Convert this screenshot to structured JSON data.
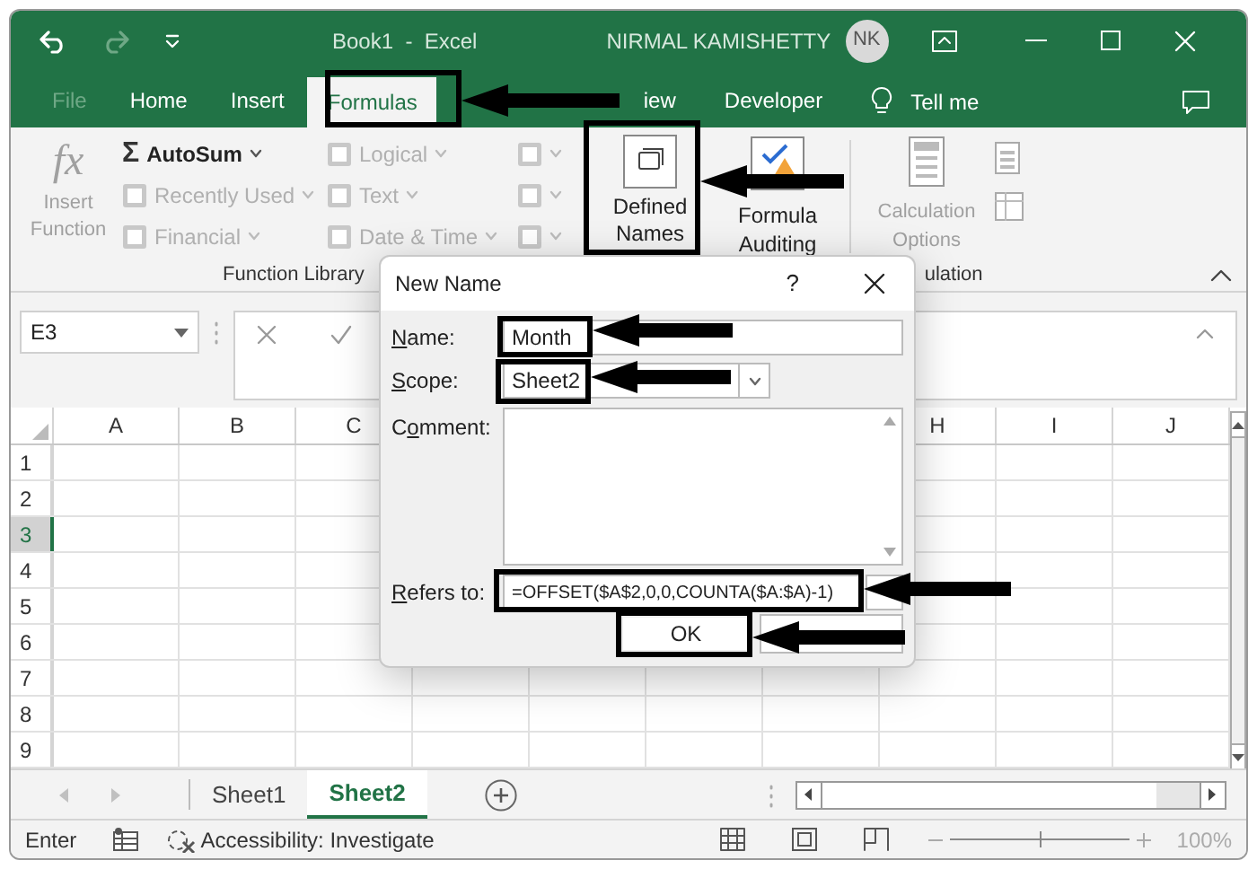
{
  "window": {
    "title": "Book1  -  Excel",
    "user": "NIRMAL KAMISHETTY",
    "avatar": "NK"
  },
  "ribbon_tabs": [
    {
      "label": "File",
      "selected": false,
      "disabled": true
    },
    {
      "label": "Home",
      "selected": false,
      "disabled": false
    },
    {
      "label": "Insert",
      "selected": false,
      "disabled": false
    },
    {
      "label": "Formulas",
      "selected": true,
      "disabled": false
    },
    {
      "label": "iew",
      "selected": false,
      "disabled": false
    },
    {
      "label": "Developer",
      "selected": false,
      "disabled": false
    }
  ],
  "tell_me": "Tell me",
  "function_library": {
    "title": "Function Library",
    "insert_function": {
      "icon": "fx",
      "label": "Insert Function",
      "disabled": true
    },
    "column_1": [
      {
        "icon": "Σ",
        "label": "AutoSum",
        "disabled": false
      },
      {
        "label": "Recently Used",
        "disabled": true
      },
      {
        "label": "Financial",
        "disabled": true
      }
    ],
    "column_2": [
      {
        "label": "Logical",
        "disabled": true
      },
      {
        "label": "Text",
        "disabled": true
      },
      {
        "label": "Date & Time",
        "disabled": true
      }
    ],
    "column_3": [
      {
        "disabled": true
      },
      {
        "disabled": true
      },
      {
        "disabled": true
      }
    ]
  },
  "defined_names": {
    "label": "Defined Names"
  },
  "formula_auditing": {
    "label": "Formula Auditing"
  },
  "calculation": {
    "title": "ulation",
    "options": {
      "label": "Calculation Options",
      "disabled": true
    }
  },
  "formula_bar": {
    "name_box": "E3"
  },
  "grid": {
    "columns_left": [
      "A",
      "B",
      "C"
    ],
    "columns_right": [
      "H",
      "I",
      "J"
    ],
    "rows": [
      {
        "label": "1",
        "selected": false
      },
      {
        "label": "2",
        "selected": false
      },
      {
        "label": "3",
        "selected": true
      },
      {
        "label": "4",
        "selected": false
      },
      {
        "label": "5",
        "selected": false
      },
      {
        "label": "6",
        "selected": false
      },
      {
        "label": "7",
        "selected": false
      },
      {
        "label": "8",
        "selected": false
      },
      {
        "label": "9",
        "selected": false
      }
    ]
  },
  "dialog": {
    "title": "New Name",
    "help": "?",
    "name": {
      "label": {
        "key": "N",
        "post": "ame:"
      },
      "value": "Month"
    },
    "scope": {
      "label": {
        "key": "S",
        "post": "cope:"
      },
      "value": "Sheet2"
    },
    "comment": {
      "label": {
        "pre": "C",
        "key": "o",
        "post": "mment:"
      }
    },
    "refers_to": {
      "label": {
        "key": "R",
        "post": "efers to:"
      },
      "value": "=OFFSET($A$2,0,0,COUNTA($A:$A)-1)"
    },
    "buttons": [
      {
        "kind": "primary",
        "label": "OK"
      },
      {
        "kind": "covered"
      }
    ]
  },
  "sheet_tabs": [
    {
      "label": "Sheet1",
      "selected": false
    },
    {
      "label": "Sheet2",
      "selected": true
    }
  ],
  "status_bar": {
    "mode": "Enter",
    "accessibility": "Accessibility: Investigate",
    "zoom_slider": {
      "level": 0.5
    },
    "zoom": "100%"
  }
}
